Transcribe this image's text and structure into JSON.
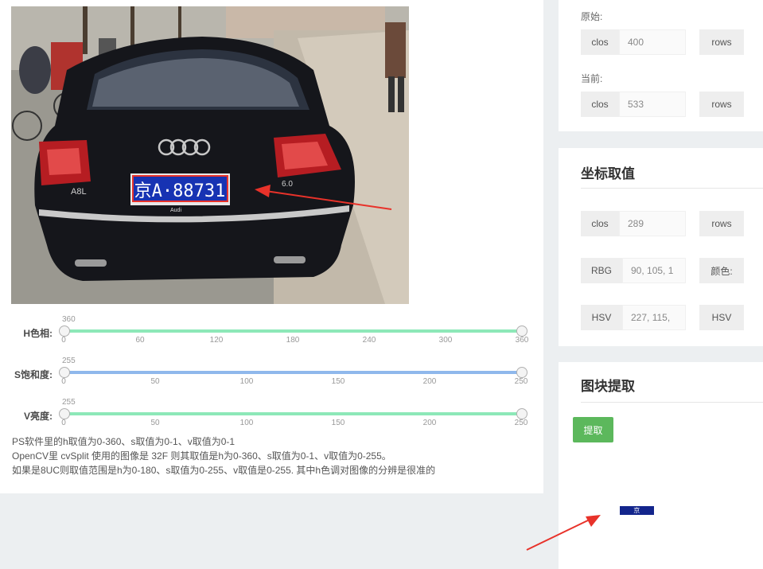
{
  "sliders": [
    {
      "label": "H色相:",
      "max_label": "360",
      "ticks": [
        "0",
        "60",
        "120",
        "180",
        "240",
        "300",
        "360"
      ],
      "color": "#8de8b8"
    },
    {
      "label": "S饱和度:",
      "max_label": "255",
      "ticks": [
        "0",
        "50",
        "100",
        "150",
        "200",
        "250"
      ],
      "color": "#8fb8ec"
    },
    {
      "label": "V亮度:",
      "max_label": "255",
      "ticks": [
        "0",
        "50",
        "100",
        "150",
        "200",
        "250"
      ],
      "color": "#8de8b8"
    }
  ],
  "notes": [
    "PS软件里的h取值为0-360、s取值为0-1、v取值为0-1",
    "OpenCV里 cvSplit 使用的图像是 32F 则其取值是h为0-360、s取值为0-1、v取值为0-255。",
    "如果是8UC则取值范围是h为0-180、s取值为0-255、v取值是0-255. 其中h色调对图像的分辨是很准的"
  ],
  "size_card": {
    "original_label": "原始:",
    "original": {
      "cols_label": "clos",
      "cols_value": "400",
      "rows_label": "rows"
    },
    "current_label": "当前:",
    "current": {
      "cols_label": "clos",
      "cols_value": "533",
      "rows_label": "rows"
    }
  },
  "coord_card": {
    "title": "坐标取值",
    "pos": {
      "cols_label": "clos",
      "cols_value": "289",
      "rows_label": "rows"
    },
    "rgb": {
      "label": "RBG",
      "value": "90, 105, 1",
      "color_label": "颜色:"
    },
    "hsv": {
      "label": "HSV",
      "value": "227, 115,",
      "label2": "HSV"
    }
  },
  "block_card": {
    "title": "图块提取",
    "button_label": "提取"
  },
  "photo": {
    "plate_text": "京A·88731",
    "badge_left": "A8L",
    "badge_right": "6.0",
    "brand_small": "Audi"
  },
  "thumb_text": "京A·88731",
  "colors": {
    "accent_green": "#5cb85c",
    "plate_blue": "#13258c",
    "arrow_red": "#e8322a"
  }
}
